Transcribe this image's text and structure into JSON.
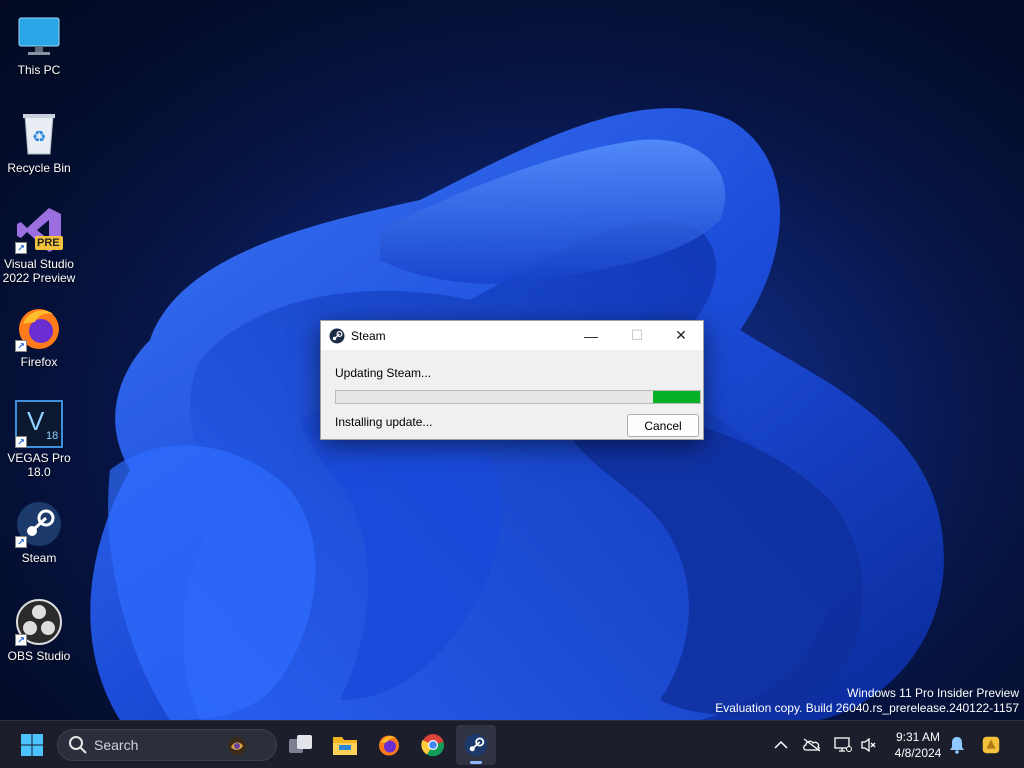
{
  "desktop": {
    "icons": [
      {
        "label": "This PC",
        "icon": "monitor-icon"
      },
      {
        "label": "Recycle Bin",
        "icon": "recycle-bin-icon"
      },
      {
        "label": "Visual Studio 2022 Preview",
        "icon": "visual-studio-icon",
        "badge": "PRE"
      },
      {
        "label": "Firefox",
        "icon": "firefox-icon"
      },
      {
        "label": "VEGAS Pro 18.0",
        "icon": "vegas-pro-icon",
        "glyph": "V",
        "version": "18"
      },
      {
        "label": "Steam",
        "icon": "steam-icon"
      },
      {
        "label": "OBS Studio",
        "icon": "obs-studio-icon"
      }
    ]
  },
  "dialog": {
    "title": "Steam",
    "minimize_glyph": "—",
    "maximize_glyph": "☐",
    "close_glyph": "✕",
    "status_text": "Updating Steam...",
    "progress_percent": 13,
    "detail_text": "Installing update...",
    "cancel_label": "Cancel",
    "progress_color": "#06b025"
  },
  "watermark": {
    "line1": "Windows 11 Pro Insider Preview",
    "line2": "Evaluation copy. Build 26040.rs_prerelease.240122-1157"
  },
  "taskbar": {
    "search_placeholder": "Search",
    "pinned": [
      "start-icon",
      "task-view-icon",
      "file-explorer-icon",
      "firefox-icon",
      "chrome-icon",
      "steam-icon"
    ],
    "time": "9:31 AM",
    "date": "4/8/2024",
    "accent": "#8fb4ff"
  }
}
